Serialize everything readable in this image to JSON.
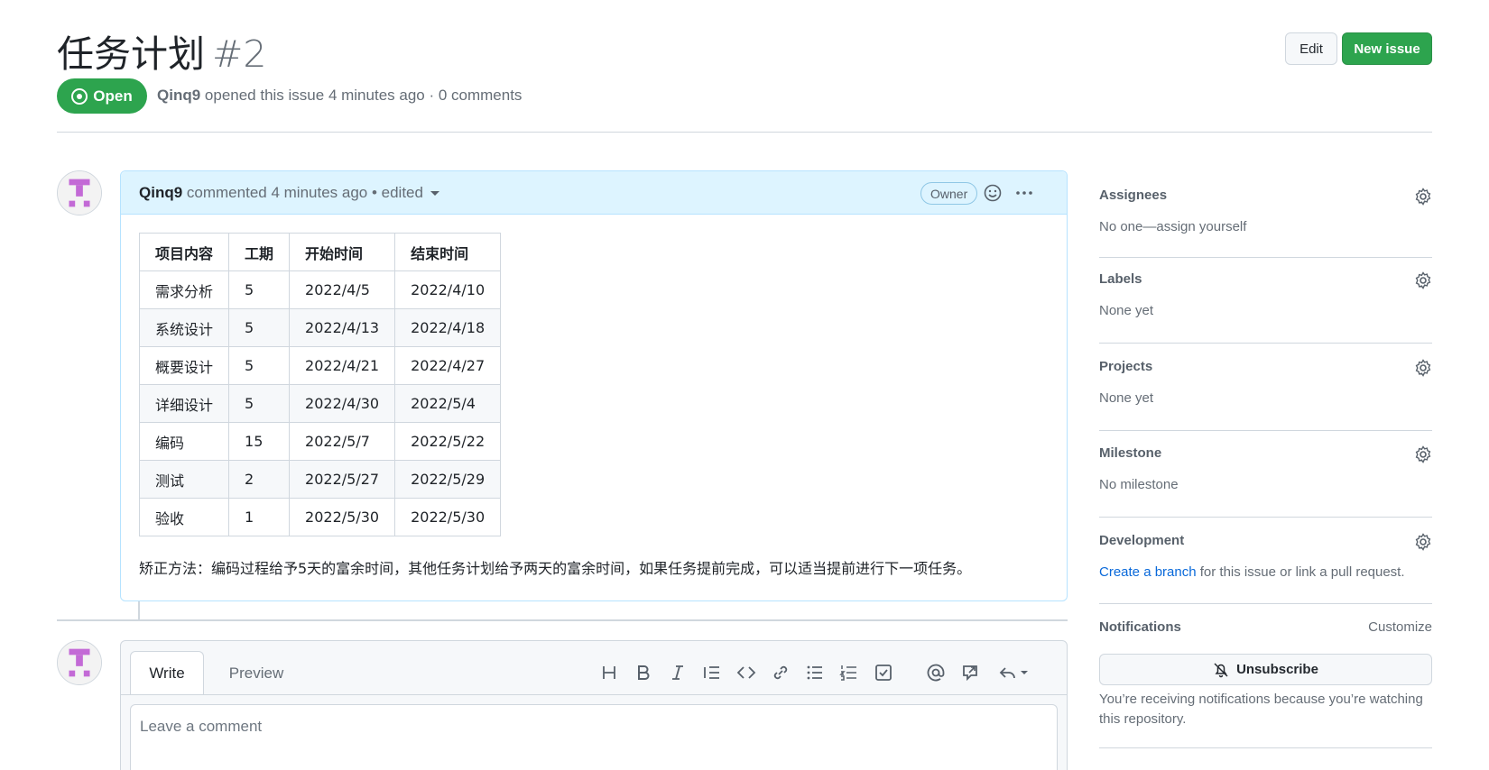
{
  "issue": {
    "title": "任务计划",
    "number": "#2",
    "state": "Open",
    "author": "Qinq9",
    "meta": "opened this issue 4 minutes ago · 0 comments"
  },
  "header_actions": {
    "edit_label": "Edit",
    "new_issue_label": "New issue"
  },
  "comment": {
    "author": "Qinq9",
    "meta": "commented 4 minutes ago • edited",
    "badge": "Owner",
    "table": {
      "headers": [
        "项目内容",
        "工期",
        "开始时间",
        "结束时间"
      ],
      "rows": [
        [
          "需求分析",
          "5",
          "2022/4/5",
          "2022/4/10"
        ],
        [
          "系统设计",
          "5",
          "2022/4/13",
          "2022/4/18"
        ],
        [
          "概要设计",
          "5",
          "2022/4/21",
          "2022/4/27"
        ],
        [
          "详细设计",
          "5",
          "2022/4/30",
          "2022/5/4"
        ],
        [
          "编码",
          "15",
          "2022/5/7",
          "2022/5/22"
        ],
        [
          "测试",
          "2",
          "2022/5/27",
          "2022/5/29"
        ],
        [
          "验收",
          "1",
          "2022/5/30",
          "2022/5/30"
        ]
      ]
    },
    "note": "矫正方法：编码过程给予5天的富余时间，其他任务计划给予两天的富余时间，如果任务提前完成，可以适当提前进行下一项任务。"
  },
  "composer": {
    "write_tab": "Write",
    "preview_tab": "Preview",
    "placeholder": "Leave a comment",
    "toolbar": [
      "heading-icon",
      "bold-icon",
      "italic-icon",
      "quote-icon",
      "code-icon",
      "link-icon",
      "bullet-list-icon",
      "numbered-list-icon",
      "task-list-icon",
      "mention-icon",
      "reference-icon",
      "reply-icon"
    ]
  },
  "sidebar": {
    "assignees": {
      "title": "Assignees",
      "value": "No one—assign yourself"
    },
    "labels": {
      "title": "Labels",
      "value": "None yet"
    },
    "projects": {
      "title": "Projects",
      "value": "None yet"
    },
    "milestone": {
      "title": "Milestone",
      "value": "No milestone"
    },
    "development": {
      "title": "Development",
      "link": "Create a branch",
      "value": " for this issue or link a pull request."
    },
    "notifications": {
      "title": "Notifications",
      "customize": "Customize",
      "button": "Unsubscribe",
      "text": "You’re receiving notifications because you’re watching this repository."
    }
  },
  "colors": {
    "green": "#2da44e",
    "link": "#0969da",
    "comment_header": "#ddf4ff",
    "avatar": "#c36ad6"
  }
}
